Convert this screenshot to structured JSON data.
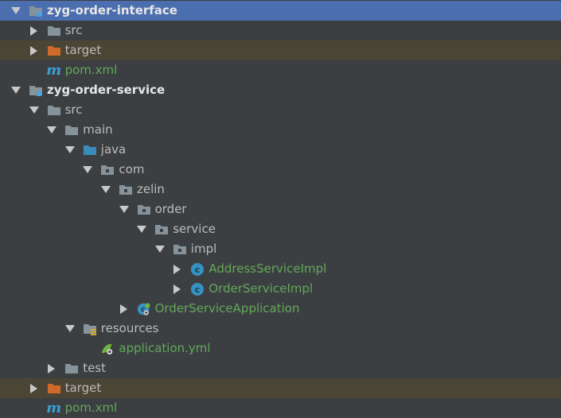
{
  "tree": {
    "rows": [
      {
        "label": "zyg-order-interface",
        "level": 0,
        "arrow": "down",
        "icon": "module-folder-icon",
        "style": "bold",
        "row": "selected"
      },
      {
        "label": "src",
        "level": 1,
        "arrow": "right",
        "icon": "folder-icon",
        "style": "normal"
      },
      {
        "label": "target",
        "level": 1,
        "arrow": "right",
        "icon": "excluded-folder-icon",
        "style": "normal",
        "row": "excluded"
      },
      {
        "label": "pom.xml",
        "level": 1,
        "arrow": "none",
        "icon": "maven-icon",
        "style": "green"
      },
      {
        "label": "zyg-order-service",
        "level": 0,
        "arrow": "down",
        "icon": "module-folder-icon",
        "style": "bold"
      },
      {
        "label": "src",
        "level": 1,
        "arrow": "down",
        "icon": "folder-icon",
        "style": "normal"
      },
      {
        "label": "main",
        "level": 2,
        "arrow": "down",
        "icon": "folder-icon",
        "style": "normal"
      },
      {
        "label": "java",
        "level": 3,
        "arrow": "down",
        "icon": "source-folder-icon",
        "style": "normal"
      },
      {
        "label": "com",
        "level": 4,
        "arrow": "down",
        "icon": "package-icon",
        "style": "normal"
      },
      {
        "label": "zelin",
        "level": 5,
        "arrow": "down",
        "icon": "package-icon",
        "style": "normal"
      },
      {
        "label": "order",
        "level": 6,
        "arrow": "down",
        "icon": "package-icon",
        "style": "normal"
      },
      {
        "label": "service",
        "level": 7,
        "arrow": "down",
        "icon": "package-icon",
        "style": "normal"
      },
      {
        "label": "impl",
        "level": 8,
        "arrow": "down",
        "icon": "package-icon",
        "style": "normal"
      },
      {
        "label": "AddressServiceImpl",
        "level": 9,
        "arrow": "right",
        "icon": "class-icon",
        "style": "green"
      },
      {
        "label": "OrderServiceImpl",
        "level": 9,
        "arrow": "right",
        "icon": "class-icon",
        "style": "green"
      },
      {
        "label": "OrderServiceApplication",
        "level": 6,
        "arrow": "right",
        "icon": "spring-boot-class-icon",
        "style": "green"
      },
      {
        "label": "resources",
        "level": 3,
        "arrow": "down",
        "icon": "resources-folder-icon",
        "style": "normal"
      },
      {
        "label": "application.yml",
        "level": 4,
        "arrow": "none",
        "icon": "spring-yml-icon",
        "style": "green"
      },
      {
        "label": "test",
        "level": 2,
        "arrow": "right",
        "icon": "folder-icon",
        "style": "normal"
      },
      {
        "label": "target",
        "level": 1,
        "arrow": "right",
        "icon": "excluded-folder-icon",
        "style": "normal",
        "row": "excluded"
      },
      {
        "label": "pom.xml",
        "level": 1,
        "arrow": "none",
        "icon": "maven-icon",
        "style": "green"
      }
    ],
    "maven_glyph": "m",
    "class_glyph": "c"
  },
  "colors": {
    "background": "#3c3f41",
    "selected_row": "#4b6eaf",
    "excluded_row": "#4b4535",
    "text": "#bbbbbb",
    "green_text": "#62a85b",
    "folder": "#87939a",
    "source_folder": "#3a8bbd",
    "excluded_folder": "#d06a2b",
    "class": "#3592c4"
  }
}
